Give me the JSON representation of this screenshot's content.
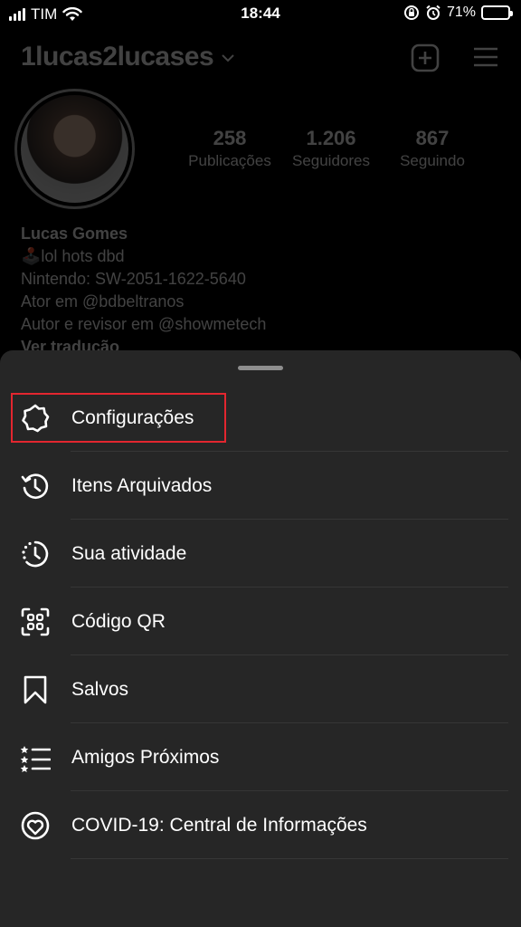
{
  "status_bar": {
    "carrier": "TIM",
    "time": "18:44",
    "battery_percent": "71%",
    "battery_level": 0.71,
    "icons": [
      "signal-icon",
      "wifi-icon",
      "orientation-lock-icon",
      "alarm-icon",
      "battery-icon"
    ]
  },
  "profile": {
    "username": "1lucas2lucases",
    "stats": [
      {
        "value": "258",
        "label": "Publicações"
      },
      {
        "value": "1.206",
        "label": "Seguidores"
      },
      {
        "value": "867",
        "label": "Seguindo"
      }
    ],
    "bio": {
      "name": "Lucas Gomes",
      "line1": "🕹️lol hots dbd",
      "line2": "Nintendo: SW-2051-1622-5640",
      "line3": "Ator em @bdbeltranos",
      "line4": "Autor e revisor em @showmetech",
      "translate_link": "Ver tradução"
    }
  },
  "menu": {
    "items": [
      {
        "label": "Configurações",
        "icon": "settings-gear-icon"
      },
      {
        "label": "Itens Arquivados",
        "icon": "archive-clock-icon"
      },
      {
        "label": "Sua atividade",
        "icon": "activity-clock-icon"
      },
      {
        "label": "Código QR",
        "icon": "qr-code-icon"
      },
      {
        "label": "Salvos",
        "icon": "bookmark-icon"
      },
      {
        "label": "Amigos Próximos",
        "icon": "close-friends-list-icon"
      },
      {
        "label": "COVID-19: Central de Informações",
        "icon": "covid-info-icon"
      }
    ]
  },
  "colors": {
    "sheet_background": "#262626",
    "highlight_border": "#e3262f"
  }
}
